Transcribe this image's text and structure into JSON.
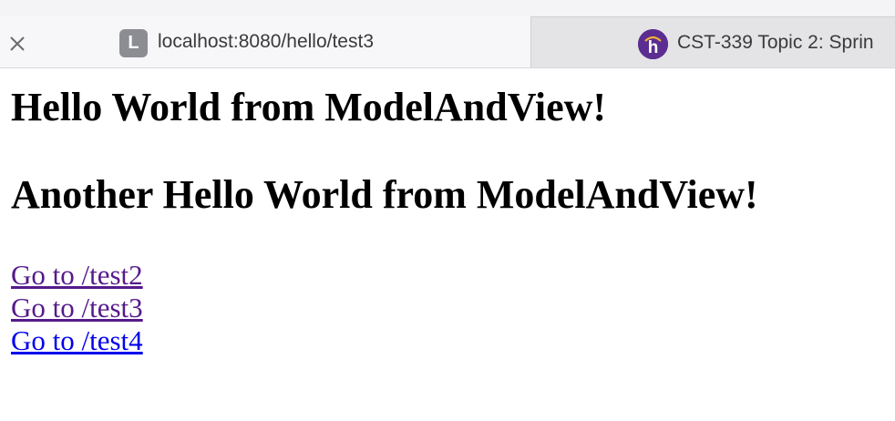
{
  "browser": {
    "tabs": [
      {
        "favicon_letter": "L",
        "favicon_color": "#8c8c93",
        "title": "localhost:8080/hello/test3",
        "active": true,
        "close_icon": "close-icon"
      },
      {
        "favicon_icon": "h-logo-icon",
        "favicon_color": "#5b2d91",
        "title": "CST-339 Topic 2: Sprin",
        "active": false
      }
    ]
  },
  "page": {
    "heading1": "Hello World from ModelAndView!",
    "heading2": "Another Hello World from ModelAndView!",
    "links": [
      {
        "label": "Go to /test2",
        "visited": true,
        "color": "#551a8b"
      },
      {
        "label": "Go to /test3",
        "visited": true,
        "color": "#551a8b"
      },
      {
        "label": "Go to /test4",
        "visited": false,
        "color": "#0000ee"
      }
    ]
  }
}
